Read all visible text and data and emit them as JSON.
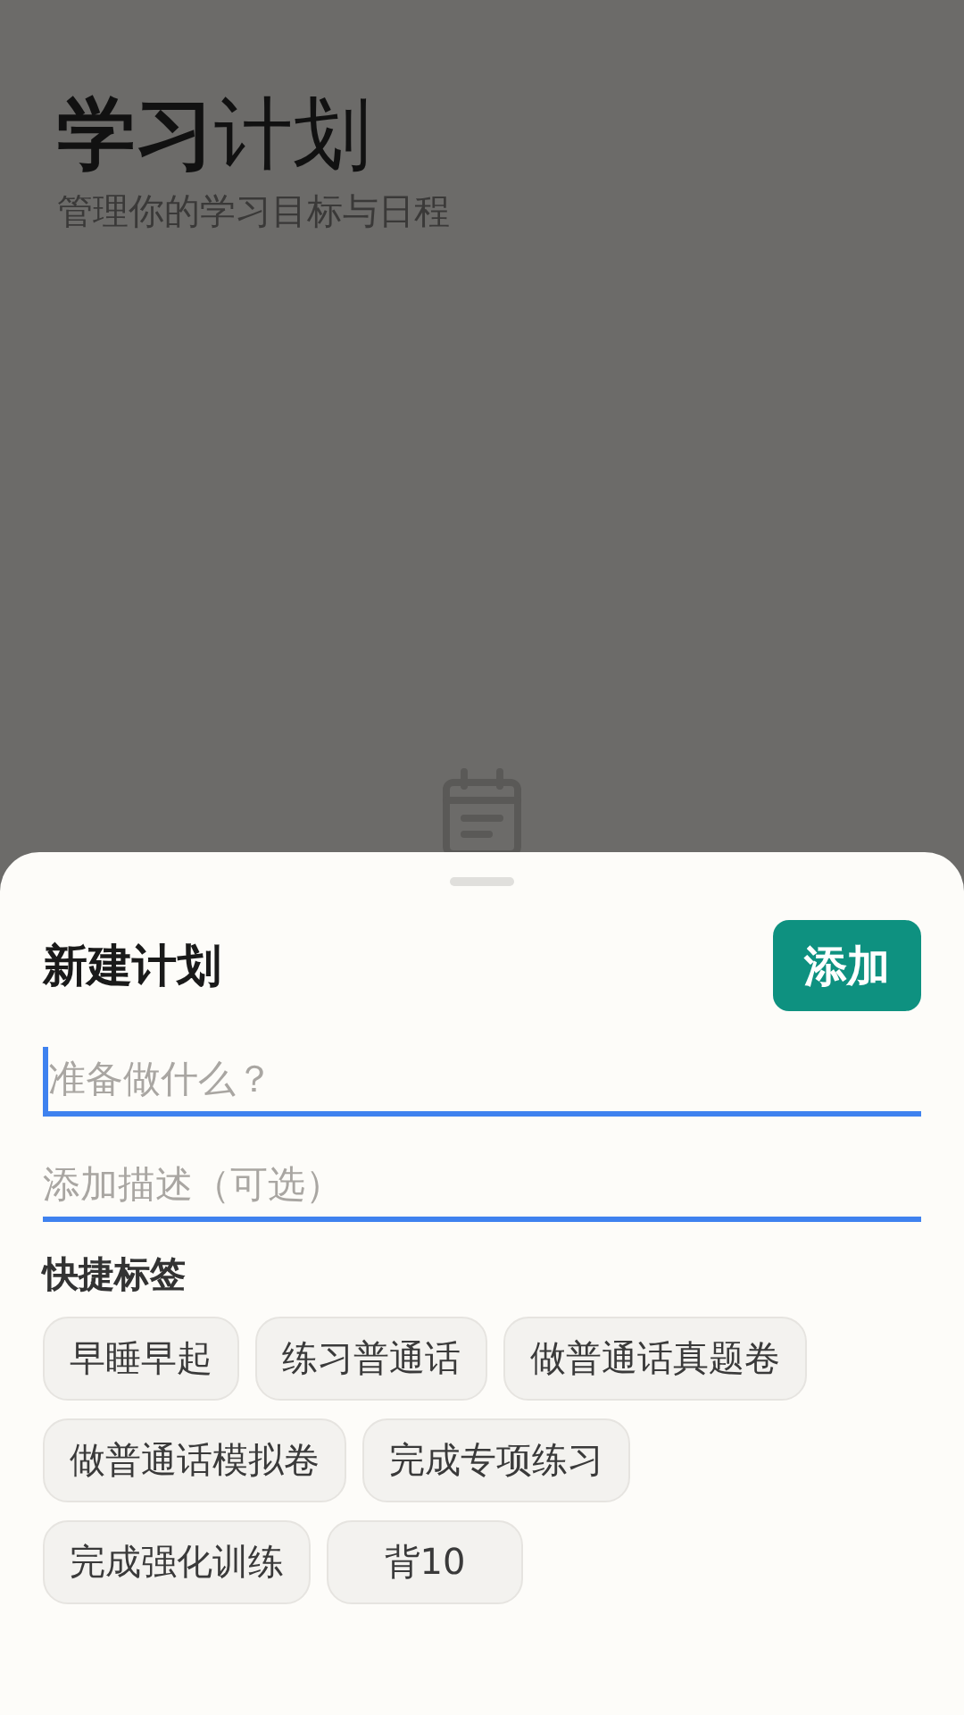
{
  "header": {
    "title": "**学习**计划",
    "subtitle": "管理你的学习目标与日程"
  },
  "sheet": {
    "title": "新建计划",
    "add_button": "添加",
    "title_field": {
      "placeholder": "准备做什么？",
      "focused": true
    },
    "description_field": {
      "placeholder": "添加描述（可选）"
    },
    "quick_tags_label": "快捷标签",
    "quick_tags": [
      "早睡早起",
      "练习普通话",
      "做普通话真题卷",
      "做普通话模拟卷",
      "完成专项练习",
      "完成强化训练",
      "背10"
    ]
  }
}
